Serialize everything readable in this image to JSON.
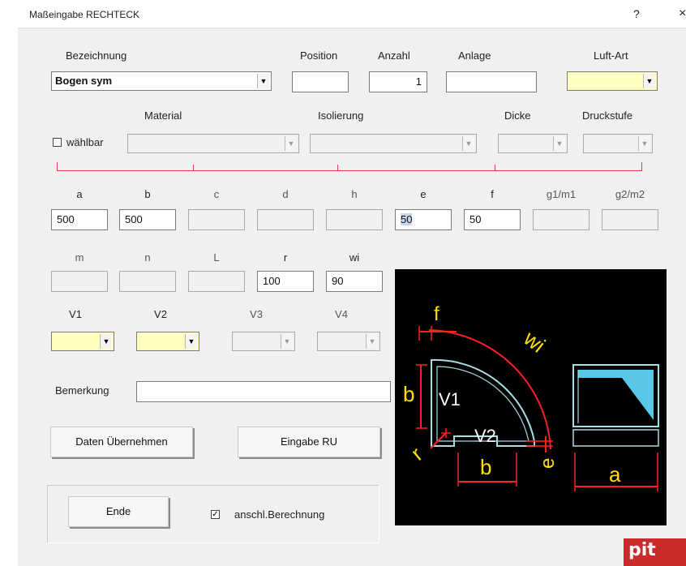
{
  "window": {
    "title": "Maßeingabe RECHTECK",
    "help_label": "?",
    "close_label": "×"
  },
  "header": {
    "bezeichnung_label": "Bezeichnung",
    "bezeichnung_value": "Bogen sym",
    "position_label": "Position",
    "position_value": "",
    "anzahl_label": "Anzahl",
    "anzahl_value": "1",
    "anlage_label": "Anlage",
    "anlage_value": "",
    "luftart_label": "Luft-Art",
    "luftart_value": ""
  },
  "material_row": {
    "waehlbar_label": "wählbar",
    "waehlbar_checked": false,
    "material_label": "Material",
    "isolierung_label": "Isolierung",
    "dicke_label": "Dicke",
    "druckstufe_label": "Druckstufe"
  },
  "dims1": [
    {
      "label": "a",
      "value": "500"
    },
    {
      "label": "b",
      "value": "500"
    },
    {
      "label": "c",
      "value": ""
    },
    {
      "label": "d",
      "value": ""
    },
    {
      "label": "h",
      "value": ""
    },
    {
      "label": "e",
      "value": "50"
    },
    {
      "label": "f",
      "value": "50"
    },
    {
      "label": "g1/m1",
      "value": ""
    },
    {
      "label": "g2/m2",
      "value": ""
    }
  ],
  "dims2": [
    {
      "label": "m",
      "value": ""
    },
    {
      "label": "n",
      "value": ""
    },
    {
      "label": "L",
      "value": ""
    },
    {
      "label": "r",
      "value": "100"
    },
    {
      "label": "wi",
      "value": "90"
    }
  ],
  "connections": [
    {
      "label": "V1",
      "value": ""
    },
    {
      "label": "V2",
      "value": ""
    },
    {
      "label": "V3",
      "value": ""
    },
    {
      "label": "V4",
      "value": ""
    }
  ],
  "remark": {
    "label": "Bemerkung",
    "value": ""
  },
  "buttons": {
    "daten": "Daten Übernehmen",
    "eingabe_ru": "Eingabe RU",
    "ende": "Ende",
    "anschl_label": "anschl.Berechnung",
    "anschl_checked": true
  },
  "diagram": {
    "f": "f",
    "wi": "wi",
    "b_left": "b",
    "v1": "V1",
    "v2": "V2",
    "r": "r",
    "b_bottom": "b",
    "e": "e",
    "a": "a",
    "colors": {
      "bg": "#000000",
      "outline": "#a8dde6",
      "dim": "#ff2020",
      "text": "#ffe000",
      "label": "#ffffff",
      "fill": "#59c8e8"
    }
  },
  "logo": "pit",
  "colors": {
    "yellow_field": "#ffffc0",
    "red_separator": "#e04040",
    "logo_red": "#c92a2a"
  }
}
